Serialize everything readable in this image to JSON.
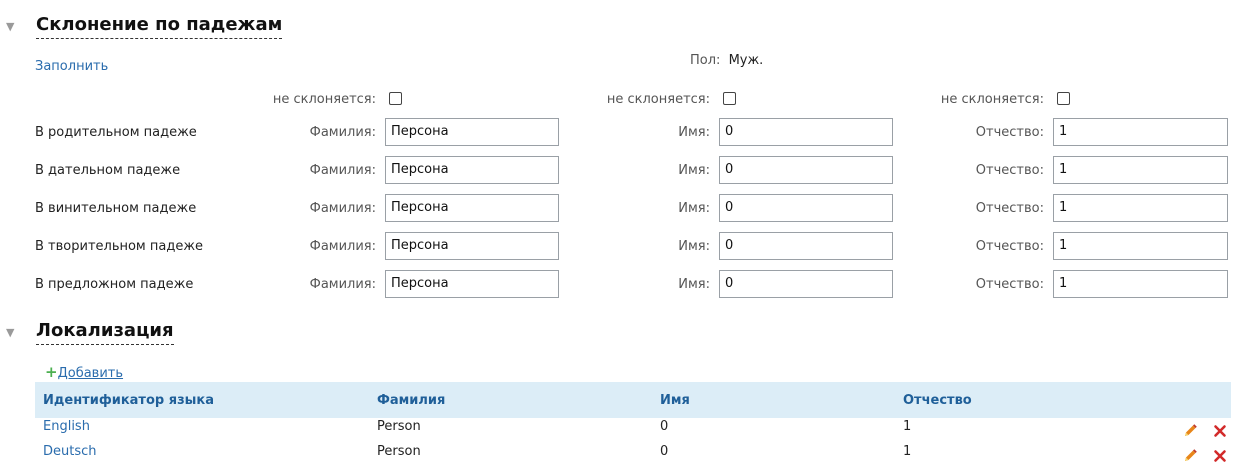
{
  "declension": {
    "title": "Склонение по падежам",
    "fill_link": "Заполнить",
    "gender_label": "Пол:",
    "gender_value": "Муж.",
    "not_declined_label": "не склоняется:",
    "last_name_label": "Фамилия:",
    "first_name_label": "Имя:",
    "patronymic_label": "Отчество:",
    "rows": [
      {
        "label": "В родительном падеже",
        "last_name": "Персона",
        "first_name": "0",
        "patronymic": "1"
      },
      {
        "label": "В дательном падеже",
        "last_name": "Персона",
        "first_name": "0",
        "patronymic": "1"
      },
      {
        "label": "В винительном падеже",
        "last_name": "Персона",
        "first_name": "0",
        "patronymic": "1"
      },
      {
        "label": "В творительном падеже",
        "last_name": "Персона",
        "first_name": "0",
        "patronymic": "1"
      },
      {
        "label": "В предложном падеже",
        "last_name": "Персона",
        "first_name": "0",
        "patronymic": "1"
      }
    ]
  },
  "localization": {
    "title": "Локализация",
    "add_link": "Добавить",
    "columns": [
      "Идентификатор языка",
      "Фамилия",
      "Имя",
      "Отчество"
    ],
    "rows": [
      {
        "language": "English",
        "last_name": "Person",
        "first_name": "0",
        "patronymic": "1"
      },
      {
        "language": "Deutsch",
        "last_name": "Person",
        "first_name": "0",
        "patronymic": "1"
      }
    ]
  },
  "colors": {
    "link": "#2a6cad",
    "header_bg": "#dcedf7",
    "header_text": "#1f5f99",
    "edit_icon": "#e8861a",
    "delete_icon": "#d22a2a",
    "add_icon": "#4caf50"
  },
  "icons": {
    "section_toggle": "triangle-down-icon",
    "edit": "pencil-icon",
    "delete": "close-icon",
    "add": "plus-icon"
  }
}
